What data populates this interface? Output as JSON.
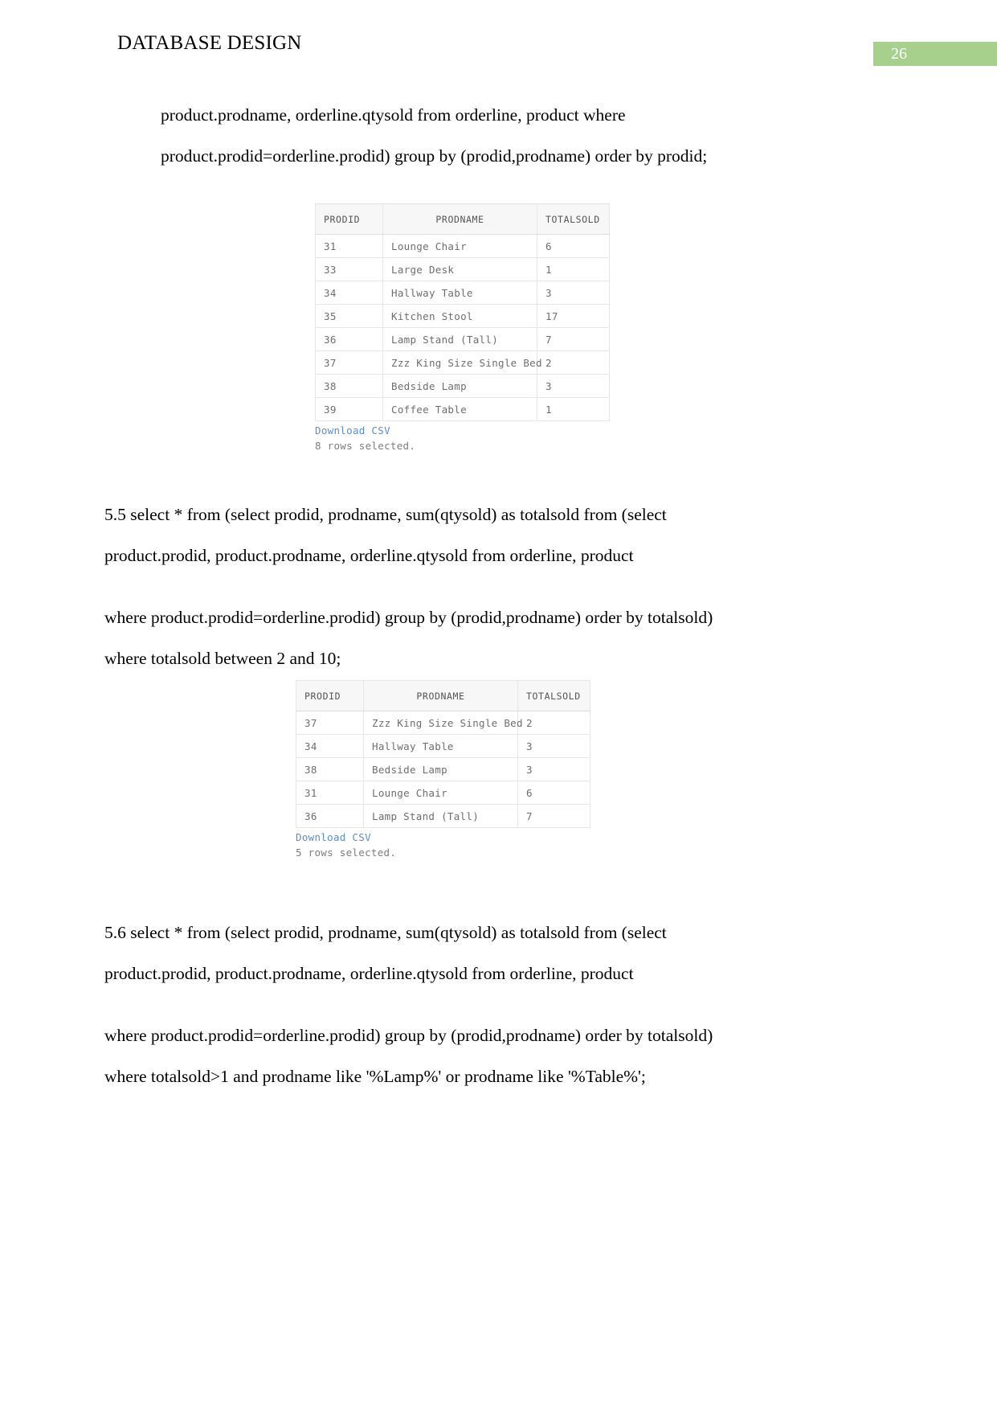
{
  "header": {
    "title": "DATABASE DESIGN",
    "page_number": "26",
    "badge_color": "#a8d08d"
  },
  "paragraphs": {
    "intro_line_1": "product.prodname, orderline.qtysold from orderline, product where",
    "intro_line_2": "product.prodid=orderline.prodid) group by (prodid,prodname) order by prodid;",
    "q55_line_1": "5.5 select * from (select prodid, prodname, sum(qtysold) as totalsold from (select",
    "q55_line_2": "product.prodid, product.prodname, orderline.qtysold from orderline, product",
    "q55_line_3": "where product.prodid=orderline.prodid) group by (prodid,prodname) order by totalsold)",
    "q55_line_4": "where totalsold between 2 and 10;",
    "q56_line_1": "5.6 select * from (select prodid, prodname, sum(qtysold) as totalsold from (select",
    "q56_line_2": "product.prodid, product.prodname, orderline.qtysold from orderline, product",
    "q56_line_3": "where product.prodid=orderline.prodid) group by (prodid,prodname) order by totalsold)",
    "q56_line_4": "where totalsold>1 and prodname like '%Lamp%' or prodname like '%Table%';"
  },
  "result_table_1": {
    "columns": [
      "PRODID",
      "PRODNAME",
      "TOTALSOLD"
    ],
    "rows": [
      [
        "31",
        "Lounge Chair",
        "6"
      ],
      [
        "33",
        "Large Desk",
        "1"
      ],
      [
        "34",
        "Hallway Table",
        "3"
      ],
      [
        "35",
        "Kitchen Stool",
        "17"
      ],
      [
        "36",
        "Lamp Stand (Tall)",
        "7"
      ],
      [
        "37",
        "Zzz King Size Single Bed",
        "2"
      ],
      [
        "38",
        "Bedside Lamp",
        "3"
      ],
      [
        "39",
        "Coffee Table",
        "1"
      ]
    ],
    "download_label": "Download CSV",
    "status": "8 rows selected."
  },
  "result_table_2": {
    "columns": [
      "PRODID",
      "PRODNAME",
      "TOTALSOLD"
    ],
    "rows": [
      [
        "37",
        "Zzz King Size Single Bed",
        "2"
      ],
      [
        "34",
        "Hallway Table",
        "3"
      ],
      [
        "38",
        "Bedside Lamp",
        "3"
      ],
      [
        "31",
        "Lounge Chair",
        "6"
      ],
      [
        "36",
        "Lamp Stand (Tall)",
        "7"
      ]
    ],
    "download_label": "Download CSV",
    "status": "5 rows selected."
  }
}
